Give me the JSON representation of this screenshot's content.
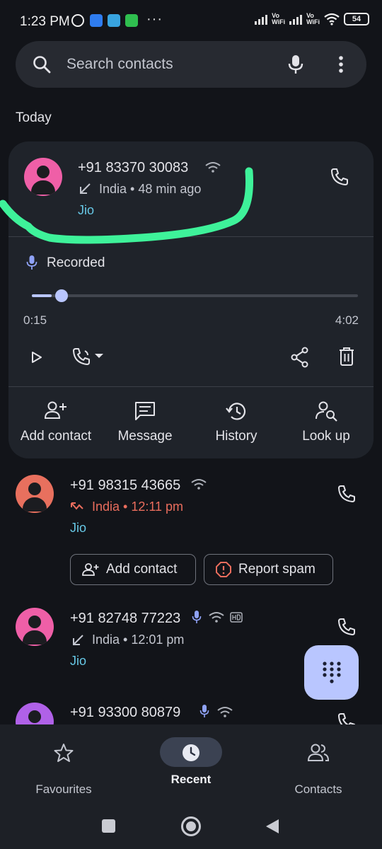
{
  "status_bar": {
    "time": "1:23 PM",
    "dots": "···",
    "vo1": "Vo",
    "wifi1": "WiFi",
    "vo2": "Vo",
    "wifi2": "WiFi",
    "battery": "54"
  },
  "search": {
    "placeholder": "Search contacts"
  },
  "section": {
    "today": "Today"
  },
  "expanded_call": {
    "number": "+91 83370 30083",
    "meta": "India • 48 min ago",
    "carrier": "Jio",
    "recorded_label": "Recorded",
    "current_time": "0:15",
    "duration": "4:02",
    "progress": 0.06,
    "avatar_color": "#ef5fa7",
    "actions": [
      {
        "label": "Add contact"
      },
      {
        "label": "Message"
      },
      {
        "label": "History"
      },
      {
        "label": "Look up"
      }
    ]
  },
  "calls": [
    {
      "number": "+91 98315 43665",
      "meta": "India • 12:11 pm",
      "carrier": "Jio",
      "type": "missed",
      "avatar_color": "#e8705e",
      "chips": [
        {
          "label": "Add contact"
        },
        {
          "label": "Report spam"
        }
      ]
    },
    {
      "number": "+91 82748 77223",
      "meta": "India • 12:01 pm",
      "carrier": "Jio",
      "type": "incoming",
      "avatar_color": "#ef5fa7"
    },
    {
      "number": "+91 93300 80879",
      "avatar_color": "#b061e8"
    }
  ],
  "bottom_nav": {
    "items": [
      {
        "label": "Favourites",
        "icon": "star-icon",
        "selected": false
      },
      {
        "label": "Recent",
        "icon": "clock-icon",
        "selected": true
      },
      {
        "label": "Contacts",
        "icon": "people-icon",
        "selected": false
      }
    ]
  },
  "colors": {
    "background": "#121419",
    "card": "#1f232a",
    "accent": "#b9c6ff",
    "carrier": "#67c8e6",
    "missed": "#ea6d5d",
    "highlight_stroke": "#3ef29a"
  }
}
